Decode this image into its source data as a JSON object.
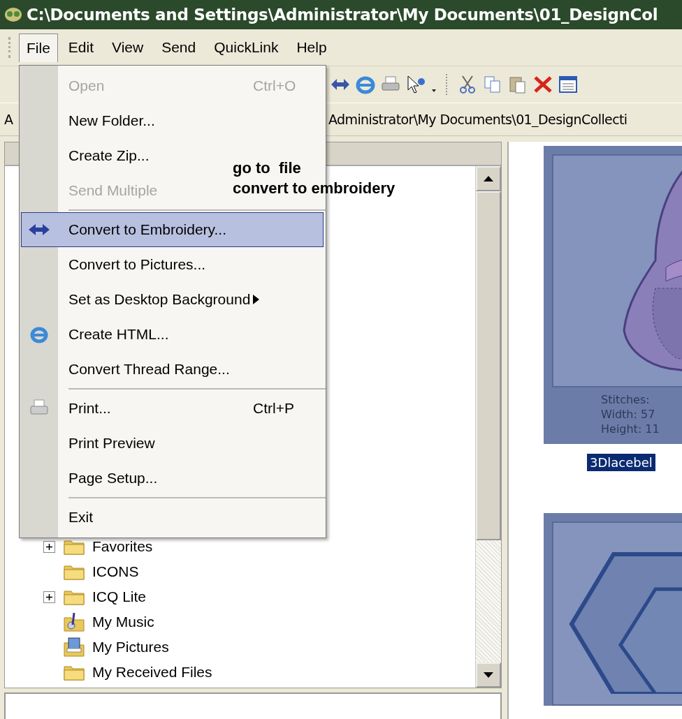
{
  "window": {
    "title": "C:\\Documents and Settings\\Administrator\\My Documents\\01_DesignCol"
  },
  "menu_bar": [
    {
      "label": "File",
      "selected": true
    },
    {
      "label": "Edit",
      "selected": false
    },
    {
      "label": "View",
      "selected": false
    },
    {
      "label": "Send",
      "selected": false
    },
    {
      "label": "QuickLink",
      "selected": false
    },
    {
      "label": "Help",
      "selected": false
    }
  ],
  "address_bar": {
    "label": "A",
    "value": "Administrator\\My Documents\\01_DesignCollecti"
  },
  "file_menu": {
    "items": [
      {
        "kind": "item",
        "label": "Open",
        "shortcut": "Ctrl+O",
        "disabled": true,
        "selected": false
      },
      {
        "kind": "item",
        "label": "New Folder...",
        "disabled": false,
        "selected": false
      },
      {
        "kind": "item",
        "label": "Create Zip...",
        "disabled": false,
        "selected": false
      },
      {
        "kind": "item",
        "label": "Send Multiple",
        "disabled": true,
        "selected": false
      },
      {
        "kind": "separator"
      },
      {
        "kind": "item",
        "label": "Convert to Embroidery...",
        "disabled": false,
        "selected": true
      },
      {
        "kind": "item",
        "label": "Convert to Pictures...",
        "disabled": false,
        "selected": false
      },
      {
        "kind": "submenu",
        "label": "Set as Desktop Background",
        "disabled": false,
        "selected": false
      },
      {
        "kind": "item",
        "label": "Create HTML...",
        "disabled": false,
        "selected": false
      },
      {
        "kind": "item",
        "label": "Convert Thread Range...",
        "disabled": false,
        "selected": false
      },
      {
        "kind": "separator"
      },
      {
        "kind": "item",
        "label": "Print...",
        "shortcut": "Ctrl+P",
        "disabled": false,
        "selected": false
      },
      {
        "kind": "item",
        "label": "Print Preview",
        "disabled": false,
        "selected": false
      },
      {
        "kind": "item",
        "label": "Page Setup...",
        "disabled": false,
        "selected": false
      },
      {
        "kind": "separator"
      },
      {
        "kind": "item",
        "label": "Exit",
        "disabled": false,
        "selected": false
      }
    ]
  },
  "annotation": {
    "lines": [
      "go to  file",
      "convert to embroidery"
    ]
  },
  "folder_tree": {
    "items": [
      {
        "label": "Favorites",
        "expandable": true
      },
      {
        "label": "ICONS",
        "expandable": false
      },
      {
        "label": "ICQ Lite",
        "expandable": true
      },
      {
        "label": "My Music",
        "expandable": false
      },
      {
        "label": "My Pictures",
        "expandable": false
      },
      {
        "label": "My Received Files",
        "expandable": false
      }
    ]
  },
  "thumbnails": [
    {
      "info": [
        "Stitches:",
        "Width: 57",
        "Height: 11"
      ],
      "caption": "3Dlacebel",
      "selected": true
    },
    {
      "selected": false
    }
  ]
}
